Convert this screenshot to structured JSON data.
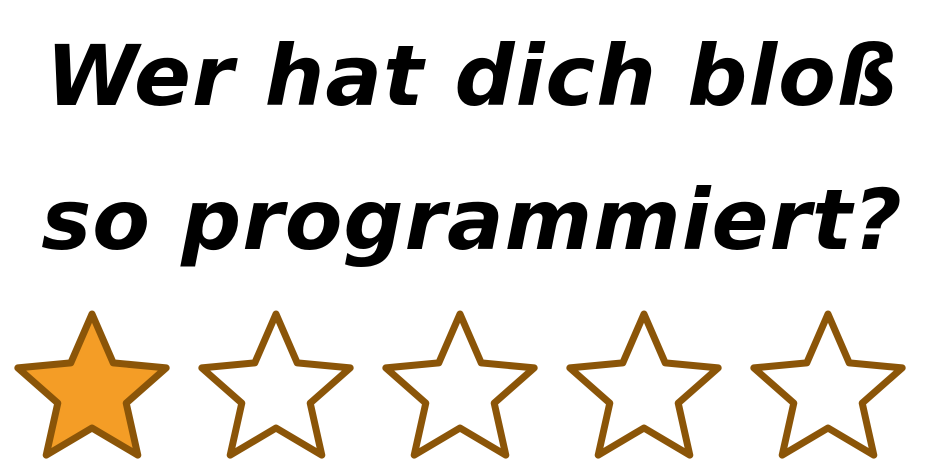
{
  "headline": {
    "line1": "Wer hat dich bloß",
    "line2": "so programmiert?"
  },
  "rating": {
    "value": 1,
    "max": 5,
    "filled_color": "#f49d26",
    "outline_color": "#8b5508",
    "empty_color": "#ffffff",
    "icon": "star-icon"
  }
}
